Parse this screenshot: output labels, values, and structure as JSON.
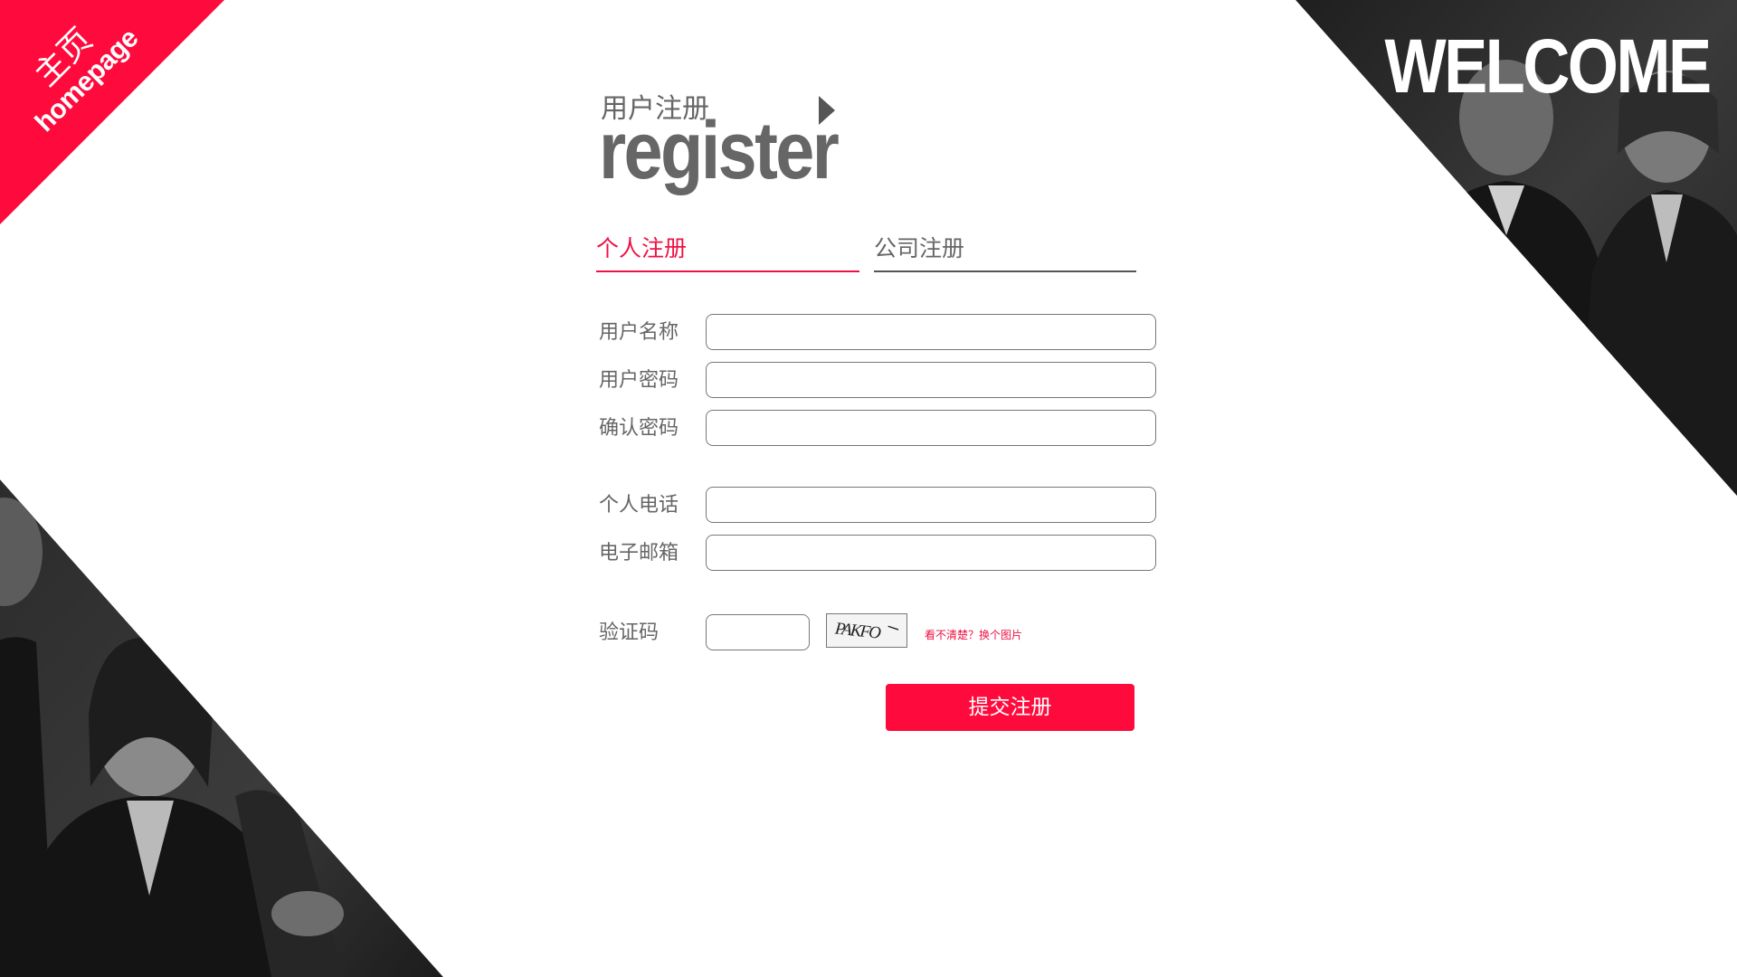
{
  "ribbon": {
    "home_cn": "主页",
    "home_en": "homepage"
  },
  "banner": {
    "welcome": "WELCOME"
  },
  "title": {
    "cn": "用户注册",
    "en": "register"
  },
  "tabs": [
    {
      "label": "个人注册",
      "active": true
    },
    {
      "label": "公司注册",
      "active": false
    }
  ],
  "form": {
    "fields": [
      {
        "label": "用户名称",
        "value": ""
      },
      {
        "label": "用户密码",
        "value": ""
      },
      {
        "label": "确认密码",
        "value": ""
      },
      {
        "label": "个人电话",
        "value": ""
      },
      {
        "label": "电子邮箱",
        "value": ""
      }
    ],
    "captcha": {
      "label": "验证码",
      "value": "",
      "image_text": "PAKFO",
      "refresh_link": "看不清楚？换个图片"
    },
    "submit_label": "提交注册"
  },
  "colors": {
    "accent": "#ff0a3c",
    "active_tab": "#ee1144",
    "text_gray": "#666666",
    "dark_panel": "#2a2a2a"
  },
  "icons": {
    "title_arrow": "triangle-right-icon"
  }
}
